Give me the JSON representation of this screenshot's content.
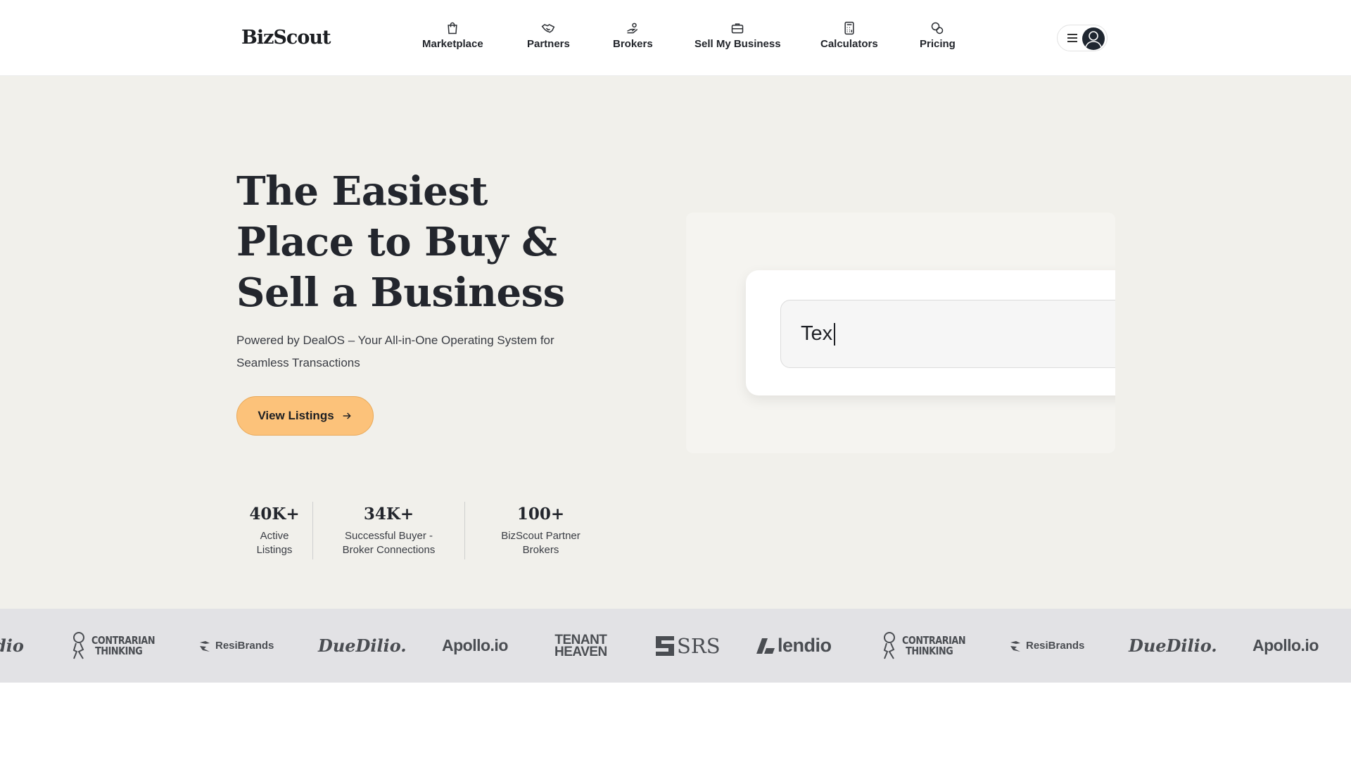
{
  "header": {
    "logo": "BizScout",
    "nav": [
      {
        "label": "Marketplace",
        "icon": "shopping-bag-icon"
      },
      {
        "label": "Partners",
        "icon": "handshake-icon"
      },
      {
        "label": "Brokers",
        "icon": "hand-coins-icon"
      },
      {
        "label": "Sell My Business",
        "icon": "briefcase-icon"
      },
      {
        "label": "Calculators",
        "icon": "calculator-icon"
      },
      {
        "label": "Pricing",
        "icon": "coins-icon"
      }
    ]
  },
  "hero": {
    "title": "The Easiest Place to Buy & Sell a Business",
    "subtitle": "Powered by DealOS – Your All-in-One Operating System for Seamless Transactions",
    "cta_label": "View Listings",
    "demo_input_value": "Tex",
    "stats": [
      {
        "value": "40K+",
        "label_line1": "Active",
        "label_line2": "Listings"
      },
      {
        "value": "34K+",
        "label_line1": "Successful Buyer -",
        "label_line2": "Broker Connections"
      },
      {
        "value": "100+",
        "label_line1": "BizScout Partner",
        "label_line2": "Brokers"
      }
    ]
  },
  "logos": {
    "partial_dilio": "dio",
    "contrarian_line1": "CONTRARIAN",
    "contrarian_line2": "THINKING",
    "resibrands": "ResiBrands",
    "duedilio": "DueDilio.",
    "apollo": "Apollo.io",
    "tenant_line1": "TENANT",
    "tenant_line2": "HEAVEN",
    "srs": "SRS",
    "lendio": "lendio"
  },
  "colors": {
    "hero_bg": "#f1f0eb",
    "cta_bg": "#fcc27a",
    "strip_bg": "#e2e2e5"
  }
}
